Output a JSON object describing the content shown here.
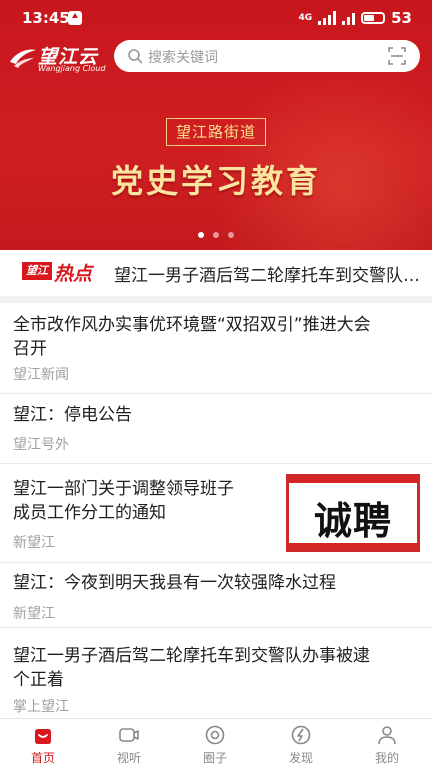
{
  "status_bar": {
    "time": "13:45",
    "network": "4G",
    "battery": "53"
  },
  "header": {
    "logo_name": "望江云",
    "logo_sub": "Wangjiang Cloud",
    "search_placeholder": "搜索关键词"
  },
  "banner": {
    "tag": "望江路街道",
    "headline": "党史学习教育",
    "slide_count": 3,
    "active_slide": 1
  },
  "hot": {
    "badge_text": "望江",
    "badge_label": "热点",
    "headline": "望江一男子酒后驾二轮摩托车到交警队办事被逮个正着"
  },
  "news": [
    {
      "title_lines": [
        "全市改作风办实事优环境暨“双招双引”推进大会",
        "召开"
      ],
      "source": "望江新闻"
    },
    {
      "title_lines": [
        "望江：停电公告"
      ],
      "source": "望江号外"
    },
    {
      "title_lines": [
        "望江一部门关于调整领导班子",
        "成员工作分工的通知"
      ],
      "source": "新望江",
      "thumb_text": "诚聘"
    },
    {
      "title_lines": [
        "望江：今夜到明天我县有一次较强降水过程"
      ],
      "source": "新望江"
    },
    {
      "title_lines": [
        "望江一男子酒后驾二轮摩托车到交警队办事被逮",
        "个正着"
      ],
      "source": "掌上望江"
    }
  ],
  "tabs": [
    {
      "label": "首页",
      "icon": "home-icon",
      "active": true
    },
    {
      "label": "视听",
      "icon": "video-icon",
      "active": false
    },
    {
      "label": "圈子",
      "icon": "circle-icon",
      "active": false
    },
    {
      "label": "发现",
      "icon": "discover-icon",
      "active": false
    },
    {
      "label": "我的",
      "icon": "profile-icon",
      "active": false
    }
  ],
  "colors": {
    "brand_red": "#d7191f",
    "banner_gold": "#fbe3a0"
  }
}
